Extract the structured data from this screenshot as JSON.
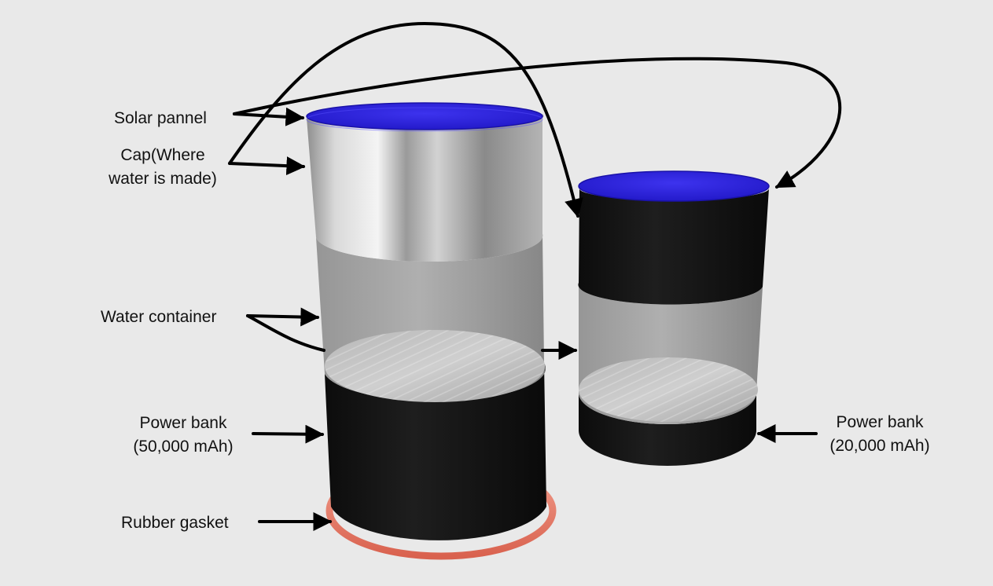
{
  "labels": {
    "solar_panel": "Solar pannel",
    "cap_line1": "Cap(Where",
    "cap_line2": "water is made)",
    "water_container": "Water container",
    "power_bank_large_line1": "Power bank",
    "power_bank_large_line2": "(50,000 mAh)",
    "rubber_gasket": "Rubber gasket",
    "power_bank_small_line1": "Power bank",
    "power_bank_small_line2": "(20,000 mAh)"
  },
  "colors": {
    "background": "#e9e9e9",
    "solar_panel": "#2a1fd6",
    "cap_metal": "#c7c7c7",
    "water_glass": "#9e9e9e",
    "power_bank": "#151515",
    "rubber_gasket": "#e8776a",
    "arrow": "#000000"
  }
}
